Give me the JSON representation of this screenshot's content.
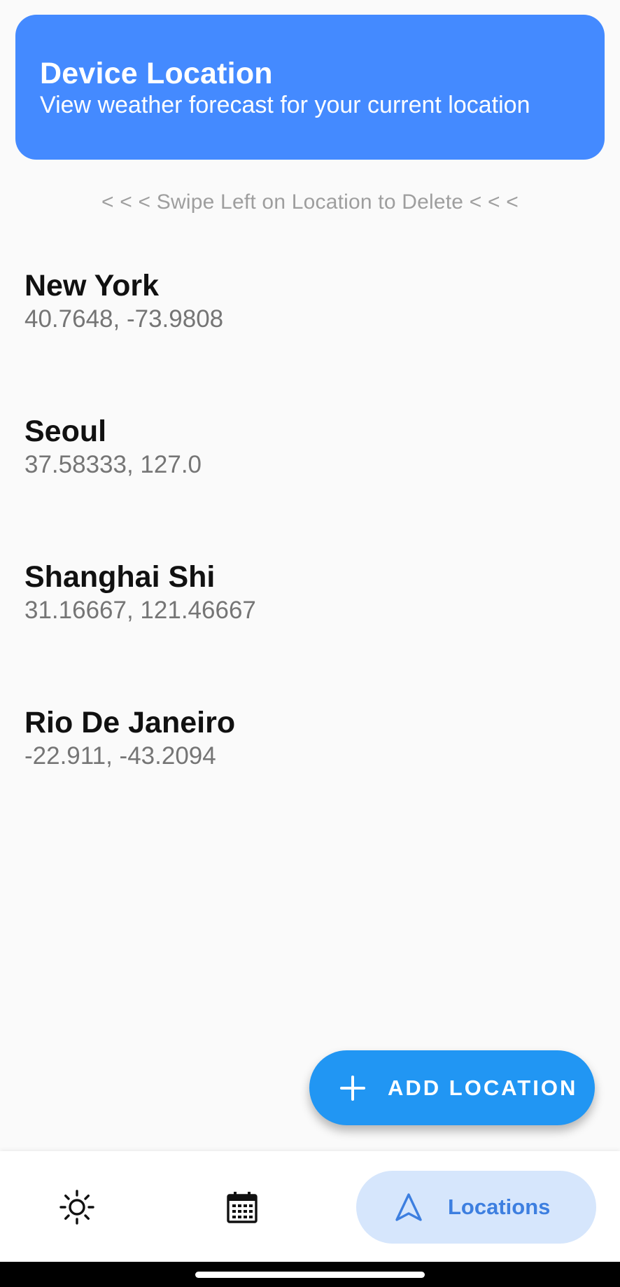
{
  "device_location": {
    "title": "Device Location",
    "subtitle": "View weather forecast for your current location",
    "background_color": "#448aff"
  },
  "swipe_hint": "< < < Swipe Left on Location to Delete < < <",
  "locations": [
    {
      "name": "New York",
      "coords": "40.7648, -73.9808"
    },
    {
      "name": "Seoul",
      "coords": "37.58333, 127.0"
    },
    {
      "name": "Shanghai Shi",
      "coords": "31.16667, 121.46667"
    },
    {
      "name": "Rio De Janeiro",
      "coords": "-22.911, -43.2094"
    }
  ],
  "fab": {
    "label": "ADD LOCATION",
    "icon": "plus-icon",
    "color": "#2196f3"
  },
  "bottom_nav": {
    "items": [
      {
        "icon": "sun-icon",
        "label": ""
      },
      {
        "icon": "calendar-icon",
        "label": ""
      },
      {
        "icon": "navigation-arrow-icon",
        "label": "Locations",
        "selected": true
      }
    ],
    "selected_color": "#d6e6fc",
    "accent_color": "#3d7fe0"
  }
}
